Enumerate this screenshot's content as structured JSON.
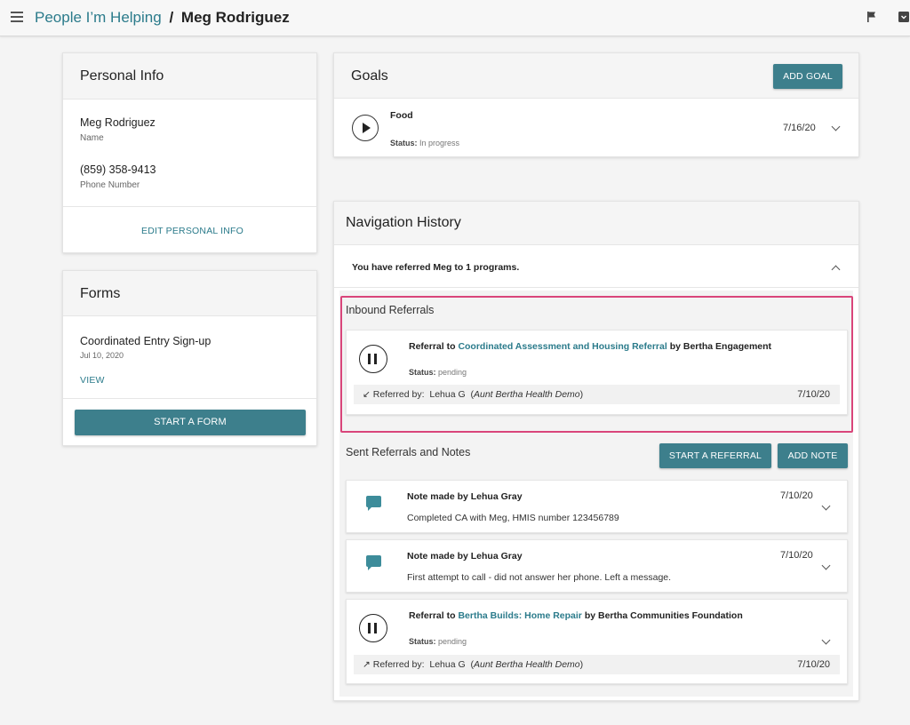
{
  "header": {
    "crumb_parent": "People I’m Helping",
    "crumb_separator": "/",
    "crumb_current": "Meg Rodriguez"
  },
  "personal_info": {
    "title": "Personal Info",
    "name_value": "Meg Rodriguez",
    "name_label": "Name",
    "phone_value": "(859) 358-9413",
    "phone_label": "Phone Number",
    "edit_label": "EDIT PERSONAL INFO"
  },
  "forms": {
    "title": "Forms",
    "form_name": "Coordinated Entry Sign-up",
    "form_date": "Jul 10, 2020",
    "view_label": "VIEW",
    "start_label": "START A FORM"
  },
  "goals": {
    "title": "Goals",
    "add_label": "ADD GOAL",
    "items": [
      {
        "name": "Food",
        "status_label": "Status:",
        "status_value": "In progress",
        "date": "7/16/20"
      }
    ]
  },
  "nav_history": {
    "title": "Navigation History",
    "summary": "You have referred Meg to 1 programs.",
    "inbound": {
      "title": "Inbound Referrals",
      "referral": {
        "prefix": "Referral to",
        "program": "Coordinated Assessment and Housing Referral",
        "suffix": "by Bertha Engagement",
        "status_label": "Status:",
        "status_value": "pending",
        "arrow": "↙",
        "referred_by_label": "Referred by:",
        "referred_by_name": "Lehua  G",
        "org": "Aunt Bertha Health Demo",
        "date": "7/10/20"
      }
    },
    "sent": {
      "title": "Sent Referrals and Notes",
      "start_referral_label": "START A REFERRAL",
      "add_note_label": "ADD NOTE",
      "notes": [
        {
          "author": "Note made by Lehua Gray",
          "text": "Completed CA with Meg, HMIS number 123456789",
          "date": "7/10/20"
        },
        {
          "author": "Note made by Lehua Gray",
          "text": "First attempt to call - did not answer her phone. Left a message.",
          "date": "7/10/20"
        }
      ],
      "referral": {
        "prefix": "Referral to",
        "program": "Bertha Builds: Home Repair",
        "suffix": "by Bertha Communities Foundation",
        "status_label": "Status:",
        "status_value": "pending",
        "arrow": "↗",
        "referred_by_label": "Referred by:",
        "referred_by_name": "Lehua  G",
        "org": "Aunt Bertha Health Demo",
        "date": "7/10/20"
      }
    }
  },
  "icons": {
    "menu": "menu-icon",
    "flag": "flag-icon",
    "archive": "archive-icon",
    "play": "play-icon",
    "pause": "pause-icon",
    "note": "comment-icon",
    "chevron": "chevron-icon"
  },
  "colors": {
    "accent": "#3d7f8c",
    "link": "#2b7b8b",
    "highlight": "#d9457a"
  }
}
